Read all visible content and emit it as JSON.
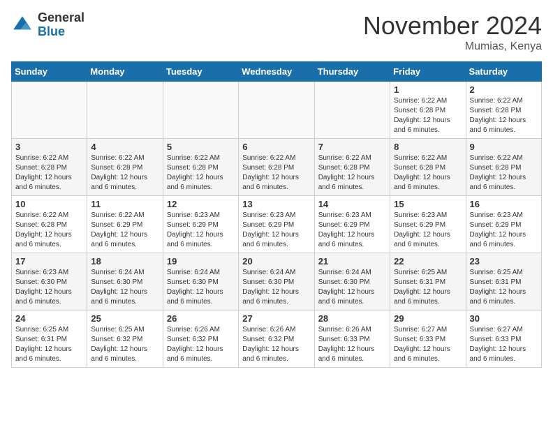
{
  "logo": {
    "general": "General",
    "blue": "Blue"
  },
  "title": "November 2024",
  "location": "Mumias, Kenya",
  "days_of_week": [
    "Sunday",
    "Monday",
    "Tuesday",
    "Wednesday",
    "Thursday",
    "Friday",
    "Saturday"
  ],
  "weeks": [
    [
      {
        "num": "",
        "info": ""
      },
      {
        "num": "",
        "info": ""
      },
      {
        "num": "",
        "info": ""
      },
      {
        "num": "",
        "info": ""
      },
      {
        "num": "",
        "info": ""
      },
      {
        "num": "1",
        "info": "Sunrise: 6:22 AM\nSunset: 6:28 PM\nDaylight: 12 hours and 6 minutes."
      },
      {
        "num": "2",
        "info": "Sunrise: 6:22 AM\nSunset: 6:28 PM\nDaylight: 12 hours and 6 minutes."
      }
    ],
    [
      {
        "num": "3",
        "info": "Sunrise: 6:22 AM\nSunset: 6:28 PM\nDaylight: 12 hours and 6 minutes."
      },
      {
        "num": "4",
        "info": "Sunrise: 6:22 AM\nSunset: 6:28 PM\nDaylight: 12 hours and 6 minutes."
      },
      {
        "num": "5",
        "info": "Sunrise: 6:22 AM\nSunset: 6:28 PM\nDaylight: 12 hours and 6 minutes."
      },
      {
        "num": "6",
        "info": "Sunrise: 6:22 AM\nSunset: 6:28 PM\nDaylight: 12 hours and 6 minutes."
      },
      {
        "num": "7",
        "info": "Sunrise: 6:22 AM\nSunset: 6:28 PM\nDaylight: 12 hours and 6 minutes."
      },
      {
        "num": "8",
        "info": "Sunrise: 6:22 AM\nSunset: 6:28 PM\nDaylight: 12 hours and 6 minutes."
      },
      {
        "num": "9",
        "info": "Sunrise: 6:22 AM\nSunset: 6:28 PM\nDaylight: 12 hours and 6 minutes."
      }
    ],
    [
      {
        "num": "10",
        "info": "Sunrise: 6:22 AM\nSunset: 6:28 PM\nDaylight: 12 hours and 6 minutes."
      },
      {
        "num": "11",
        "info": "Sunrise: 6:22 AM\nSunset: 6:29 PM\nDaylight: 12 hours and 6 minutes."
      },
      {
        "num": "12",
        "info": "Sunrise: 6:23 AM\nSunset: 6:29 PM\nDaylight: 12 hours and 6 minutes."
      },
      {
        "num": "13",
        "info": "Sunrise: 6:23 AM\nSunset: 6:29 PM\nDaylight: 12 hours and 6 minutes."
      },
      {
        "num": "14",
        "info": "Sunrise: 6:23 AM\nSunset: 6:29 PM\nDaylight: 12 hours and 6 minutes."
      },
      {
        "num": "15",
        "info": "Sunrise: 6:23 AM\nSunset: 6:29 PM\nDaylight: 12 hours and 6 minutes."
      },
      {
        "num": "16",
        "info": "Sunrise: 6:23 AM\nSunset: 6:29 PM\nDaylight: 12 hours and 6 minutes."
      }
    ],
    [
      {
        "num": "17",
        "info": "Sunrise: 6:23 AM\nSunset: 6:30 PM\nDaylight: 12 hours and 6 minutes."
      },
      {
        "num": "18",
        "info": "Sunrise: 6:24 AM\nSunset: 6:30 PM\nDaylight: 12 hours and 6 minutes."
      },
      {
        "num": "19",
        "info": "Sunrise: 6:24 AM\nSunset: 6:30 PM\nDaylight: 12 hours and 6 minutes."
      },
      {
        "num": "20",
        "info": "Sunrise: 6:24 AM\nSunset: 6:30 PM\nDaylight: 12 hours and 6 minutes."
      },
      {
        "num": "21",
        "info": "Sunrise: 6:24 AM\nSunset: 6:30 PM\nDaylight: 12 hours and 6 minutes."
      },
      {
        "num": "22",
        "info": "Sunrise: 6:25 AM\nSunset: 6:31 PM\nDaylight: 12 hours and 6 minutes."
      },
      {
        "num": "23",
        "info": "Sunrise: 6:25 AM\nSunset: 6:31 PM\nDaylight: 12 hours and 6 minutes."
      }
    ],
    [
      {
        "num": "24",
        "info": "Sunrise: 6:25 AM\nSunset: 6:31 PM\nDaylight: 12 hours and 6 minutes."
      },
      {
        "num": "25",
        "info": "Sunrise: 6:25 AM\nSunset: 6:32 PM\nDaylight: 12 hours and 6 minutes."
      },
      {
        "num": "26",
        "info": "Sunrise: 6:26 AM\nSunset: 6:32 PM\nDaylight: 12 hours and 6 minutes."
      },
      {
        "num": "27",
        "info": "Sunrise: 6:26 AM\nSunset: 6:32 PM\nDaylight: 12 hours and 6 minutes."
      },
      {
        "num": "28",
        "info": "Sunrise: 6:26 AM\nSunset: 6:33 PM\nDaylight: 12 hours and 6 minutes."
      },
      {
        "num": "29",
        "info": "Sunrise: 6:27 AM\nSunset: 6:33 PM\nDaylight: 12 hours and 6 minutes."
      },
      {
        "num": "30",
        "info": "Sunrise: 6:27 AM\nSunset: 6:33 PM\nDaylight: 12 hours and 6 minutes."
      }
    ]
  ]
}
